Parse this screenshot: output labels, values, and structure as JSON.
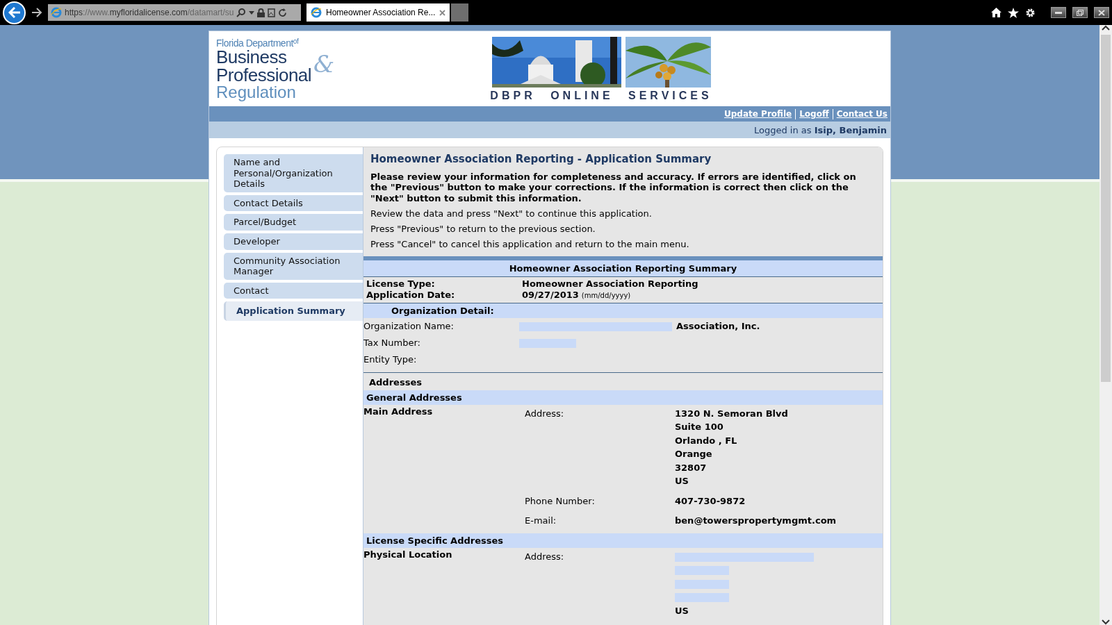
{
  "browser": {
    "url": {
      "scheme": "https",
      "prefix": "://www.",
      "domain": "myfloridalicense.com",
      "path": "/datamart/su"
    },
    "tab": {
      "title": "Homeowner Association Re..."
    }
  },
  "header": {
    "logo": {
      "line1": "Florida Department",
      "line1_small": "of",
      "line2": "Business",
      "line3": "Professional",
      "line4": "Regulation",
      "ampersand": "&"
    },
    "banner_text": "DBPR ONLINE SERVICES",
    "links": [
      "Update Profile",
      "Logoff",
      "Contact Us"
    ],
    "logged_in": {
      "prefix": "Logged in as",
      "user": "Isip, Benjamin"
    }
  },
  "sidebar": {
    "items": [
      {
        "label": "Name and Personal/Organization Details",
        "selected": false
      },
      {
        "label": "Contact Details",
        "selected": false
      },
      {
        "label": "Parcel/Budget",
        "selected": false
      },
      {
        "label": "Developer",
        "selected": false
      },
      {
        "label": "Community Association Manager",
        "selected": false
      },
      {
        "label": "Contact",
        "selected": false
      },
      {
        "label": "Application Summary",
        "selected": true
      }
    ]
  },
  "main": {
    "title": "Homeowner Association Reporting - Application Summary",
    "intro": "Please review your information for completeness and accuracy. If errors are identified, click on the \"Previous\" button to make your corrections. If the information is correct then click on the \"Next\" button to submit this information.",
    "notes": [
      "Review the data and press \"Next\" to continue this application.",
      "Press \"Previous\" to return to the previous section.",
      "Press \"Cancel\" to cancel this application and return to the main menu."
    ],
    "summary": {
      "heading": "Homeowner Association Reporting Summary",
      "license_type_label": "License Type:",
      "license_type": "Homeowner Association Reporting",
      "application_date_label": "Application Date:",
      "application_date": "09/27/2013",
      "date_hint": "(mm/dd/yyyy)"
    },
    "organization": {
      "heading": "Organization Detail:",
      "fields": [
        {
          "label": "Organization Name:",
          "value": "Association, Inc.",
          "redacted": true
        },
        {
          "label": "Tax Number:",
          "redacted": true
        },
        {
          "label": "Entity Type:",
          "redacted": false
        }
      ]
    },
    "addresses": {
      "heading": "Addresses",
      "groups": [
        {
          "title": "General Addresses",
          "entries": [
            {
              "name": "Main Address",
              "rows": [
                {
                  "label": "Address:",
                  "lines": [
                    {
                      "kind": "text",
                      "text": "1320 N. Semoran Blvd"
                    },
                    {
                      "kind": "text",
                      "text": "Suite 100"
                    },
                    {
                      "kind": "text",
                      "text": "Orlando , FL"
                    },
                    {
                      "kind": "text",
                      "text": "Orange"
                    },
                    {
                      "kind": "text",
                      "text": "32807"
                    },
                    {
                      "kind": "text",
                      "text": "US"
                    }
                  ]
                },
                {
                  "label": "Phone Number:",
                  "lines": [
                    {
                      "kind": "text",
                      "text": "407-730-9872"
                    }
                  ]
                },
                {
                  "label": "E-mail:",
                  "lines": [
                    {
                      "kind": "text",
                      "text": "ben@towerspropertymgmt.com"
                    }
                  ]
                }
              ]
            }
          ]
        },
        {
          "title": "License Specific Addresses",
          "entries": [
            {
              "name": "Physical Location",
              "rows": [
                {
                  "label": "Address:",
                  "lines": [
                    {
                      "kind": "redactedwide"
                    },
                    {
                      "kind": "redacted"
                    },
                    {
                      "kind": "redacted"
                    },
                    {
                      "kind": "redacted"
                    },
                    {
                      "kind": "text",
                      "text": "US"
                    }
                  ]
                }
              ]
            }
          ]
        }
      ]
    }
  }
}
